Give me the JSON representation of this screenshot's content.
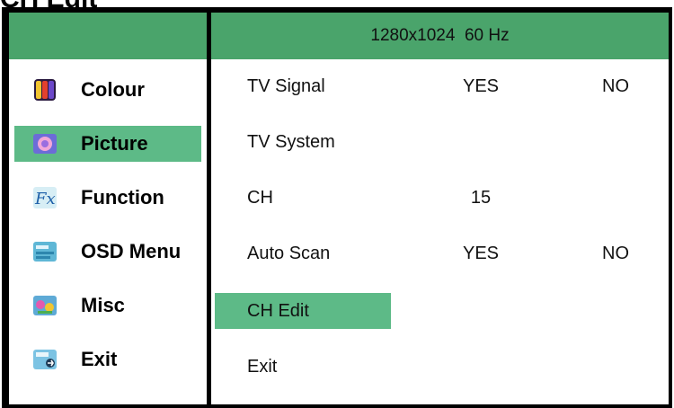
{
  "page": {
    "heading": "CH Edit"
  },
  "header": {
    "resolution": "1280x1024  60 Hz"
  },
  "sidebar": {
    "items": [
      {
        "label": "Colour",
        "icon": "colour-bars-icon",
        "selected": false
      },
      {
        "label": "Picture",
        "icon": "picture-icon",
        "selected": true
      },
      {
        "label": "Function",
        "icon": "fx-icon",
        "selected": false
      },
      {
        "label": "OSD Menu",
        "icon": "osd-menu-icon",
        "selected": false
      },
      {
        "label": "Misc",
        "icon": "misc-icon",
        "selected": false
      },
      {
        "label": "Exit",
        "icon": "exit-icon",
        "selected": false
      }
    ]
  },
  "main": {
    "rows": [
      {
        "label": "TV Signal",
        "value1": "YES",
        "value2": "NO",
        "selected": false
      },
      {
        "label": "TV  System",
        "value1": "",
        "value2": "",
        "selected": false
      },
      {
        "label": "CH",
        "value1": "15",
        "value2": "",
        "selected": false
      },
      {
        "label": "Auto  Scan",
        "value1": "YES",
        "value2": "NO",
        "selected": false
      },
      {
        "label": "CH  Edit",
        "value1": "",
        "value2": "",
        "selected": true
      },
      {
        "label": "Exit",
        "value1": "",
        "value2": "",
        "selected": false
      }
    ]
  },
  "colors": {
    "header_green": "#4aa46b",
    "highlight_green": "#5dba87",
    "frame": "#000000"
  }
}
